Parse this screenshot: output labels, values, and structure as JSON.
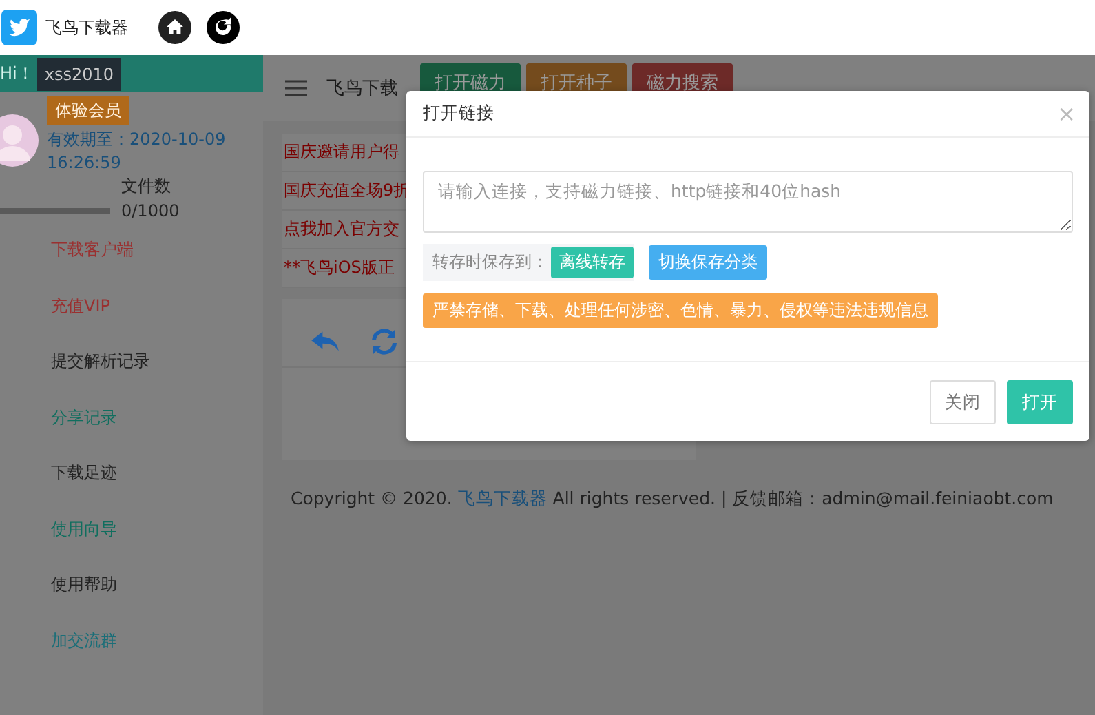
{
  "topbar": {
    "title": "飞鸟下载器"
  },
  "sidebar": {
    "greeting": "Hi！",
    "username": "xss2010",
    "member_badge": "体验会员",
    "expiry": "有效期至：2020-10-09 16:26:59",
    "files_label": "文件数",
    "files_count": "0/1000",
    "files_usage": {
      "level": 0
    },
    "items": [
      {
        "label": "下载客户端",
        "color": "#9a3030"
      },
      {
        "label": "充值VIP",
        "color": "#9a3030"
      },
      {
        "label": "提交解析记录",
        "color": "#222222"
      },
      {
        "label": "分享记录",
        "color": "#0f6e5e"
      },
      {
        "label": "下载足迹",
        "color": "#222222"
      },
      {
        "label": "使用向导",
        "color": "#0f6e5e"
      },
      {
        "label": "使用帮助",
        "color": "#222222"
      },
      {
        "label": "加交流群",
        "color": "#1a6e78"
      }
    ]
  },
  "header": {
    "title": "飞鸟下载",
    "buttons": [
      {
        "label": "打开磁力",
        "kind": "green"
      },
      {
        "label": "打开种子",
        "kind": "orange"
      },
      {
        "label": "磁力搜索",
        "kind": "red"
      }
    ]
  },
  "notices": [
    "国庆邀请用户得",
    "国庆充值全场9折",
    "点我加入官方交",
    "**飞鸟iOS版正"
  ],
  "footer": {
    "prefix": "Copyright © 2020.",
    "link": "飞鸟下载器",
    "suffix": "All rights reserved. | 反馈邮箱：admin@mail.feiniaobt.com"
  },
  "dialog": {
    "title": "打开链接",
    "close": "×",
    "input": {
      "placeholder": "请输入连接，支持磁力链接、http链接和40位hash"
    },
    "save_label": "转存时保存到：",
    "save_target": "离线转存",
    "switch_button": "切换保存分类",
    "warning": "严禁存储、下载、处理任何涉密、色情、暴力、侵权等违法违规信息",
    "buttons": [
      {
        "label": "关闭",
        "kind": "default"
      },
      {
        "label": "打开",
        "kind": "primary"
      }
    ]
  }
}
